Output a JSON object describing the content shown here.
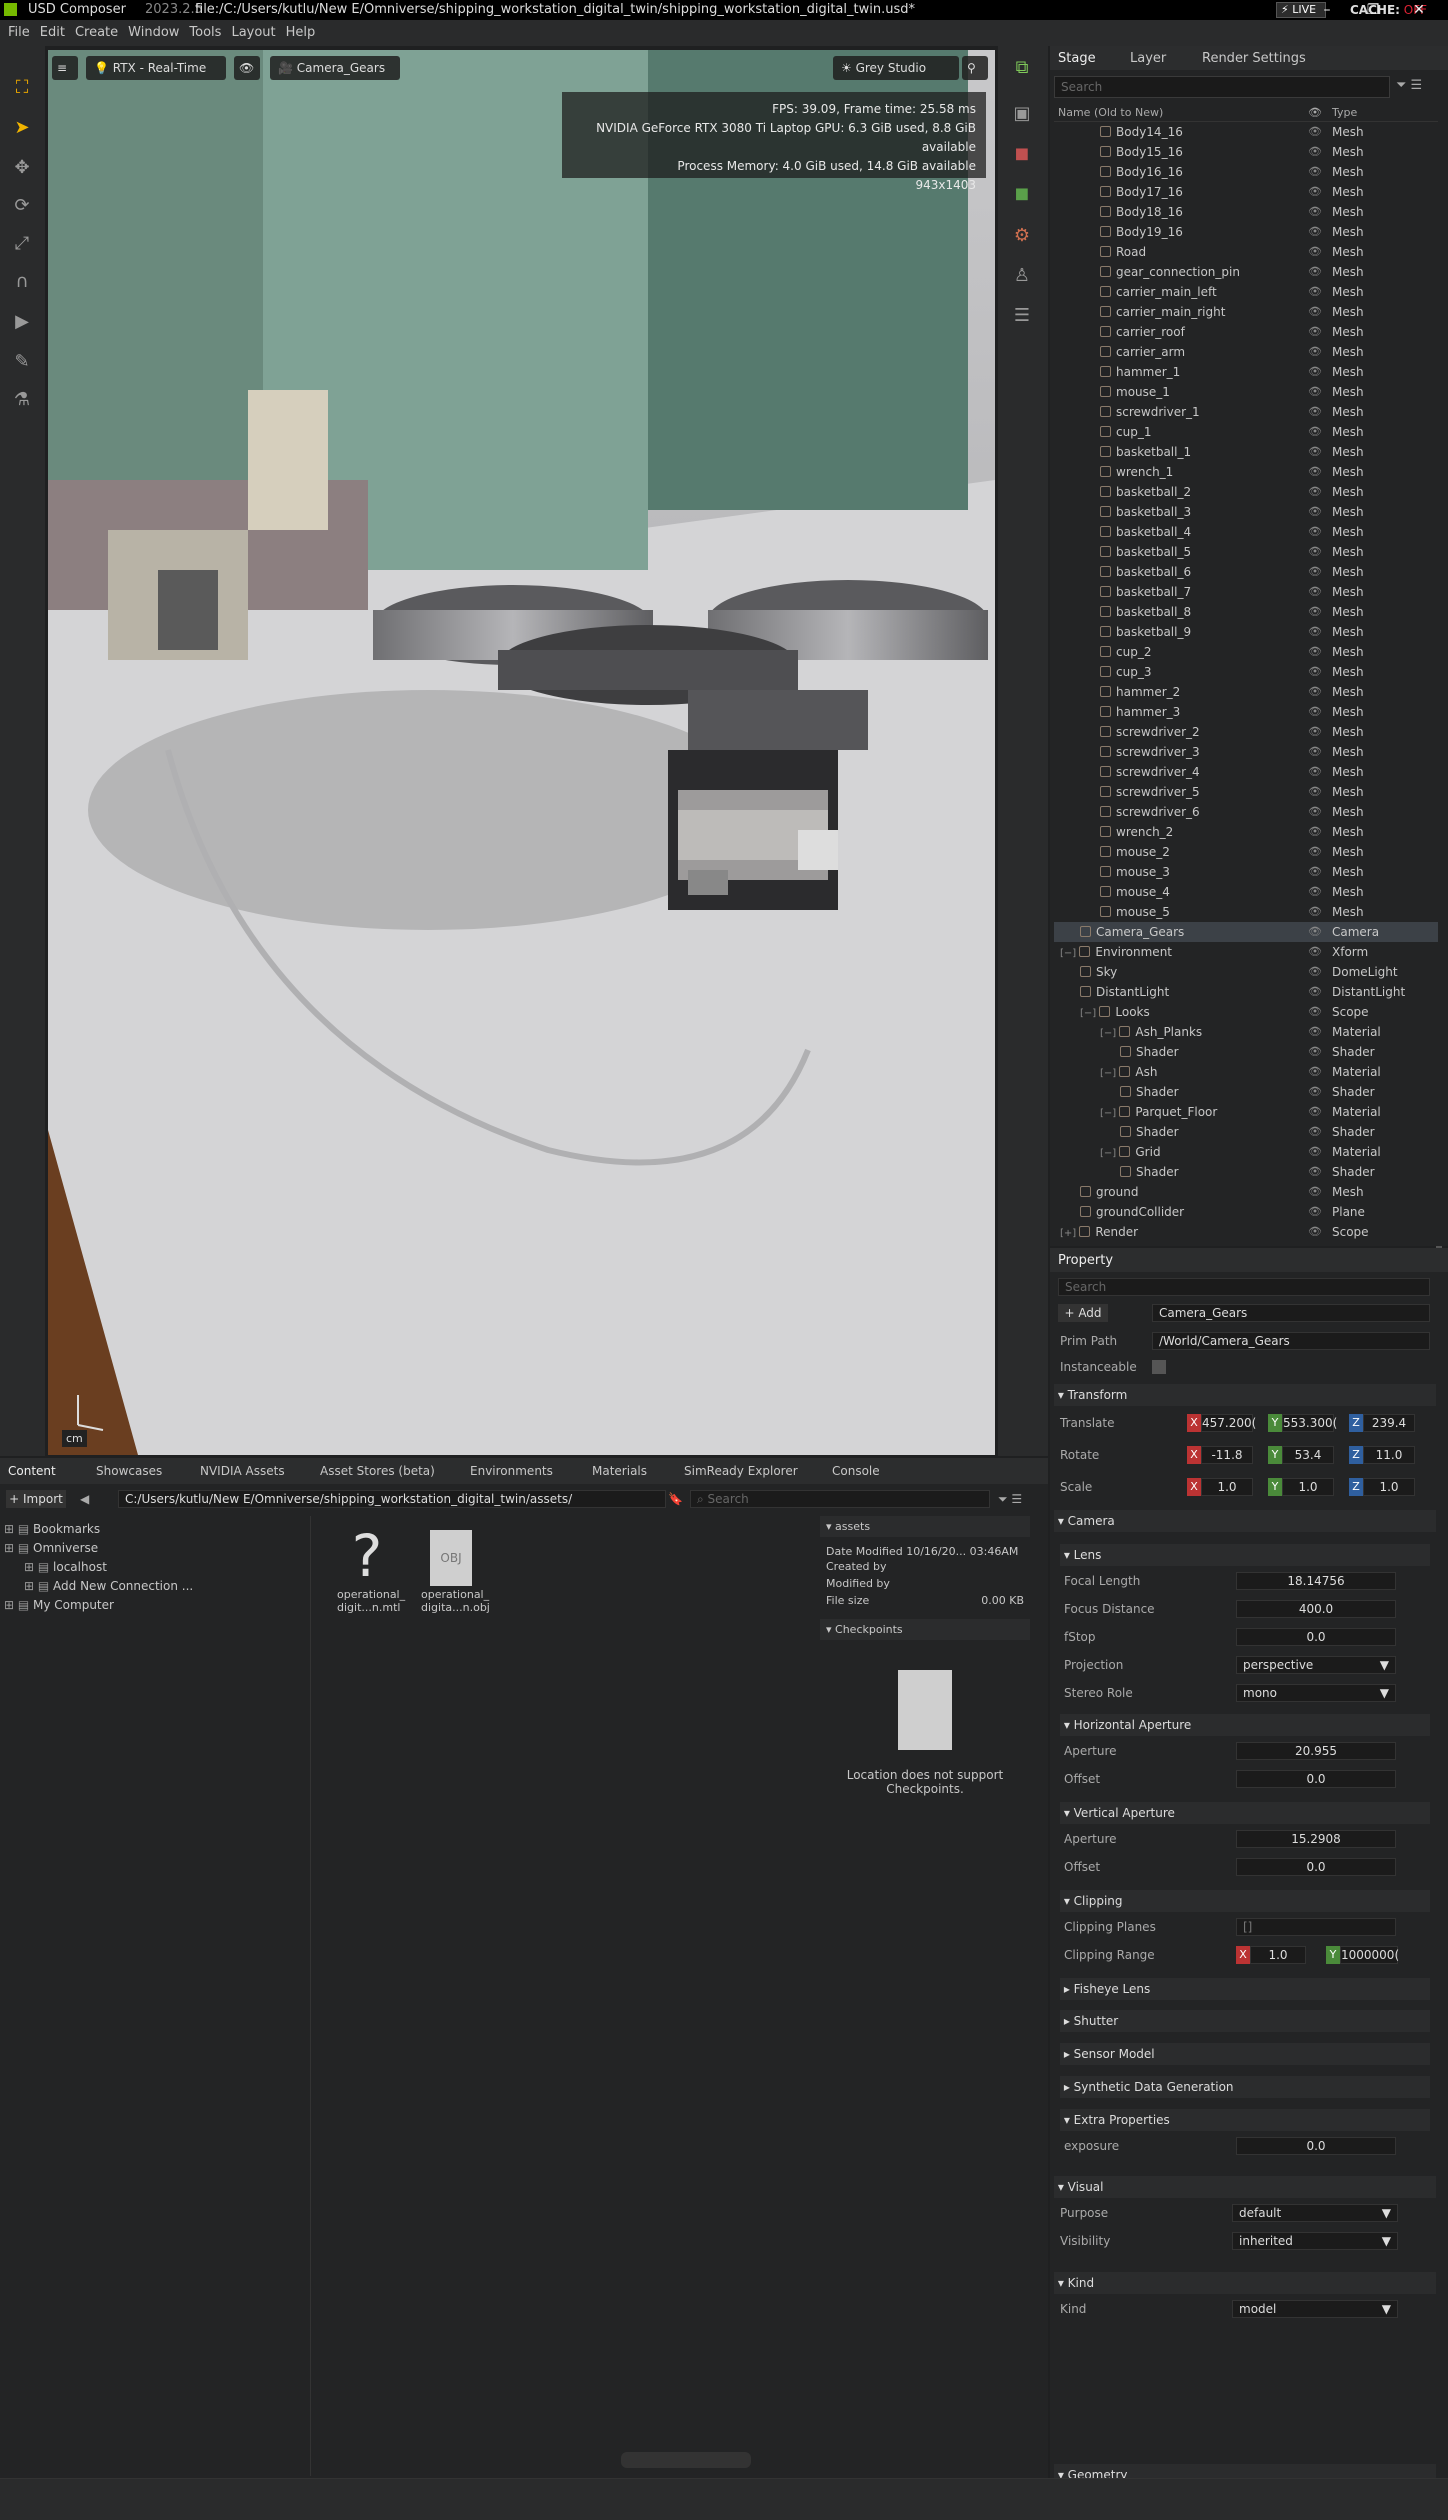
{
  "titlebar": {
    "app": "USD Composer",
    "version": "2023.2.5",
    "file": "file:/C:/Users/kutlu/New E/Omniverse/shipping_workstation_digital_twin/shipping_workstation_digital_twin.usd*",
    "live": "LIVE",
    "cache_label": "CACHE:",
    "cache_state": "OFF"
  },
  "menu": [
    "File",
    "Edit",
    "Create",
    "Window",
    "Tools",
    "Layout",
    "Help"
  ],
  "viewport": {
    "renderer": "RTX - Real-Time",
    "camera": "Camera_Gears",
    "lighting": "Grey Studio",
    "stats": [
      "FPS: 39.09, Frame time: 25.58 ms",
      "NVIDIA GeForce RTX 3080 Ti Laptop GPU: 6.3 GiB used, 8.8 GiB available",
      "Process Memory: 4.0 GiB used, 14.8 GiB available",
      "943x1403"
    ],
    "units": "cm"
  },
  "stage": {
    "tabs": [
      "Stage",
      "Layer",
      "Render Settings"
    ],
    "search_placeholder": "Search",
    "col_name": "Name (Old to New)",
    "col_type": "Type",
    "rows": [
      {
        "name": "Body14_16",
        "type": "Mesh",
        "indent": 2
      },
      {
        "name": "Body15_16",
        "type": "Mesh",
        "indent": 2
      },
      {
        "name": "Body16_16",
        "type": "Mesh",
        "indent": 2
      },
      {
        "name": "Body17_16",
        "type": "Mesh",
        "indent": 2
      },
      {
        "name": "Body18_16",
        "type": "Mesh",
        "indent": 2
      },
      {
        "name": "Body19_16",
        "type": "Mesh",
        "indent": 2
      },
      {
        "name": "Road",
        "type": "Mesh",
        "indent": 2
      },
      {
        "name": "gear_connection_pin",
        "type": "Mesh",
        "indent": 2
      },
      {
        "name": "carrier_main_left",
        "type": "Mesh",
        "indent": 2
      },
      {
        "name": "carrier_main_right",
        "type": "Mesh",
        "indent": 2
      },
      {
        "name": "carrier_roof",
        "type": "Mesh",
        "indent": 2
      },
      {
        "name": "carrier_arm",
        "type": "Mesh",
        "indent": 2
      },
      {
        "name": "hammer_1",
        "type": "Mesh",
        "indent": 2
      },
      {
        "name": "mouse_1",
        "type": "Mesh",
        "indent": 2
      },
      {
        "name": "screwdriver_1",
        "type": "Mesh",
        "indent": 2
      },
      {
        "name": "cup_1",
        "type": "Mesh",
        "indent": 2
      },
      {
        "name": "basketball_1",
        "type": "Mesh",
        "indent": 2
      },
      {
        "name": "wrench_1",
        "type": "Mesh",
        "indent": 2
      },
      {
        "name": "basketball_2",
        "type": "Mesh",
        "indent": 2
      },
      {
        "name": "basketball_3",
        "type": "Mesh",
        "indent": 2
      },
      {
        "name": "basketball_4",
        "type": "Mesh",
        "indent": 2
      },
      {
        "name": "basketball_5",
        "type": "Mesh",
        "indent": 2
      },
      {
        "name": "basketball_6",
        "type": "Mesh",
        "indent": 2
      },
      {
        "name": "basketball_7",
        "type": "Mesh",
        "indent": 2
      },
      {
        "name": "basketball_8",
        "type": "Mesh",
        "indent": 2
      },
      {
        "name": "basketball_9",
        "type": "Mesh",
        "indent": 2
      },
      {
        "name": "cup_2",
        "type": "Mesh",
        "indent": 2
      },
      {
        "name": "cup_3",
        "type": "Mesh",
        "indent": 2
      },
      {
        "name": "hammer_2",
        "type": "Mesh",
        "indent": 2
      },
      {
        "name": "hammer_3",
        "type": "Mesh",
        "indent": 2
      },
      {
        "name": "screwdriver_2",
        "type": "Mesh",
        "indent": 2
      },
      {
        "name": "screwdriver_3",
        "type": "Mesh",
        "indent": 2
      },
      {
        "name": "screwdriver_4",
        "type": "Mesh",
        "indent": 2
      },
      {
        "name": "screwdriver_5",
        "type": "Mesh",
        "indent": 2
      },
      {
        "name": "screwdriver_6",
        "type": "Mesh",
        "indent": 2
      },
      {
        "name": "wrench_2",
        "type": "Mesh",
        "indent": 2
      },
      {
        "name": "mouse_2",
        "type": "Mesh",
        "indent": 2
      },
      {
        "name": "mouse_3",
        "type": "Mesh",
        "indent": 2
      },
      {
        "name": "mouse_4",
        "type": "Mesh",
        "indent": 2
      },
      {
        "name": "mouse_5",
        "type": "Mesh",
        "indent": 2
      },
      {
        "name": "Camera_Gears",
        "type": "Camera",
        "indent": 1,
        "selected": true
      },
      {
        "name": "Environment",
        "type": "Xform",
        "indent": 0,
        "expander": "−"
      },
      {
        "name": "Sky",
        "type": "DomeLight",
        "indent": 1
      },
      {
        "name": "DistantLight",
        "type": "DistantLight",
        "indent": 1
      },
      {
        "name": "Looks",
        "type": "Scope",
        "indent": 1,
        "expander": "−"
      },
      {
        "name": "Ash_Planks",
        "type": "Material",
        "indent": 2,
        "expander": "−"
      },
      {
        "name": "Shader",
        "type": "Shader",
        "indent": 3
      },
      {
        "name": "Ash",
        "type": "Material",
        "indent": 2,
        "expander": "−"
      },
      {
        "name": "Shader",
        "type": "Shader",
        "indent": 3
      },
      {
        "name": "Parquet_Floor",
        "type": "Material",
        "indent": 2,
        "expander": "−"
      },
      {
        "name": "Shader",
        "type": "Shader",
        "indent": 3
      },
      {
        "name": "Grid",
        "type": "Material",
        "indent": 2,
        "expander": "−"
      },
      {
        "name": "Shader",
        "type": "Shader",
        "indent": 3
      },
      {
        "name": "ground",
        "type": "Mesh",
        "indent": 1
      },
      {
        "name": "groundCollider",
        "type": "Plane",
        "indent": 1
      },
      {
        "name": "Render",
        "type": "Scope",
        "indent": 0,
        "expander": "+"
      }
    ]
  },
  "property": {
    "tab": "Property",
    "search_placeholder": "Search",
    "add": "Add",
    "prim_name": "Camera_Gears",
    "prim_path_label": "Prim Path",
    "prim_path": "/World/Camera_Gears",
    "instanceable_label": "Instanceable",
    "transform": {
      "header": "Transform",
      "translate_label": "Translate",
      "translate": [
        "457.200(",
        "553.300(",
        "239.4"
      ],
      "rotate_label": "Rotate",
      "rotate": [
        "-11.8",
        "53.4",
        "11.0"
      ],
      "scale_label": "Scale",
      "scale": [
        "1.0",
        "1.0",
        "1.0"
      ]
    },
    "camera": {
      "header": "Camera",
      "lens_header": "Lens",
      "focal_length_label": "Focal Length",
      "focal_length": "18.14756",
      "focus_distance_label": "Focus Distance",
      "focus_distance": "400.0",
      "fstop_label": "fStop",
      "fstop": "0.0",
      "projection_label": "Projection",
      "projection": "perspective",
      "stereo_label": "Stereo Role",
      "stereo": "mono",
      "haperture_header": "Horizontal Aperture",
      "haperture_label": "Aperture",
      "haperture": "20.955",
      "hoffset_label": "Offset",
      "hoffset": "0.0",
      "vaperture_header": "Vertical Aperture",
      "vaperture_label": "Aperture",
      "vaperture": "15.2908",
      "voffset_label": "Offset",
      "voffset": "0.0",
      "clipping_header": "Clipping",
      "clip_planes_label": "Clipping Planes",
      "clip_planes": "[]",
      "clip_range_label": "Clipping Range",
      "clip_near": "1.0",
      "clip_far": "1000000(",
      "collapsed": [
        "Fisheye Lens",
        "Shutter",
        "Sensor Model",
        "Synthetic Data Generation"
      ],
      "extra_header": "Extra Properties",
      "exposure_label": "exposure",
      "exposure": "0.0"
    },
    "visual": {
      "header": "Visual",
      "purpose_label": "Purpose",
      "purpose": "default",
      "visibility_label": "Visibility",
      "visibility": "inherited"
    },
    "kind": {
      "header": "Kind",
      "kind_label": "Kind",
      "kind": "model"
    },
    "geometry_header": "Geometry"
  },
  "content": {
    "tabs": [
      "Content",
      "Showcases",
      "NVIDIA Assets",
      "Asset Stores (beta)",
      "Environments",
      "Materials",
      "SimReady Explorer",
      "Console"
    ],
    "import": "Import",
    "path": "C:/Users/kutlu/New E/Omniverse/shipping_workstation_digital_twin/assets/",
    "search_placeholder": "Search",
    "tree": [
      {
        "label": "Bookmarks",
        "indent": 0
      },
      {
        "label": "Omniverse",
        "indent": 0
      },
      {
        "label": "localhost",
        "indent": 1
      },
      {
        "label": "Add New Connection ...",
        "indent": 1
      },
      {
        "label": "My Computer",
        "indent": 0
      }
    ],
    "files": [
      {
        "name": "operational_\ndigit...n.mtl",
        "icon": "?"
      },
      {
        "name": "operational_\ndigita...n.obj",
        "icon": "OBJ"
      }
    ],
    "details": {
      "folder": "assets",
      "date": "Date Modified 10/16/20... 03:46AM",
      "created": "Created by",
      "modified": "Modified by",
      "filesize_label": "File size",
      "filesize": "0.00 KB",
      "checkpoints": "Checkpoints",
      "note": "Location does not support Checkpoints."
    }
  }
}
